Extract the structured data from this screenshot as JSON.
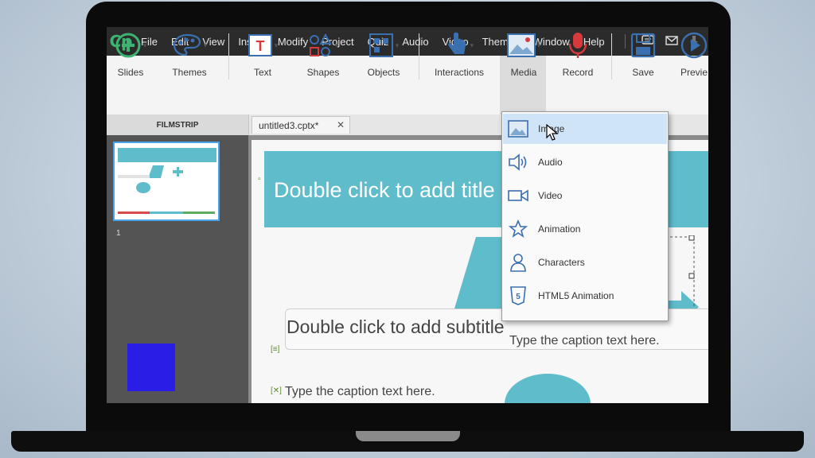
{
  "menubar": {
    "logo": "Cp",
    "items": [
      "File",
      "Edit",
      "View",
      "Insert",
      "Modify",
      "Project",
      "Quiz",
      "Audio",
      "Video",
      "Themes",
      "Window",
      "Help"
    ],
    "right_icons": [
      "comment-icon",
      "mail-icon",
      "download-arrow-icon"
    ]
  },
  "toolbar": {
    "tools": [
      {
        "label": "Slides",
        "icon": "add-slide-icon"
      },
      {
        "label": "Themes",
        "icon": "palette-icon"
      },
      {
        "label": "Text",
        "icon": "text-icon"
      },
      {
        "label": "Shapes",
        "icon": "shapes-icon"
      },
      {
        "label": "Objects",
        "icon": "objects-icon"
      },
      {
        "label": "Interactions",
        "icon": "hand-pointer-icon"
      },
      {
        "label": "Media",
        "icon": "image-icon"
      },
      {
        "label": "Record",
        "icon": "microphone-icon"
      },
      {
        "label": "Save",
        "icon": "floppy-icon"
      },
      {
        "label": "Previe",
        "icon": "play-icon"
      }
    ]
  },
  "panels": {
    "filmstrip_title": "FILMSTRIP",
    "doc_tab": "untitled3.cptx*",
    "slide_number": "1"
  },
  "slide": {
    "title_placeholder": "Double click to add title",
    "subtitle_placeholder": "Double click to add subtitle",
    "caption_left": "Type the caption text here.",
    "caption_right": "Type the caption text here."
  },
  "media_menu": {
    "items": [
      {
        "label": "Image",
        "icon": "image-icon",
        "highlighted": true
      },
      {
        "label": "Audio",
        "icon": "speaker-icon"
      },
      {
        "label": "Video",
        "icon": "video-camera-icon"
      },
      {
        "label": "Animation",
        "icon": "star-icon"
      },
      {
        "label": "Characters",
        "icon": "person-icon"
      },
      {
        "label": "HTML5 Animation",
        "icon": "html5-icon"
      }
    ]
  },
  "colors": {
    "accent_teal": "#5fbccb",
    "selection_blue": "#4aa3e8",
    "logo_green": "#3cb371",
    "overlay_logo": "#2a1de6"
  }
}
